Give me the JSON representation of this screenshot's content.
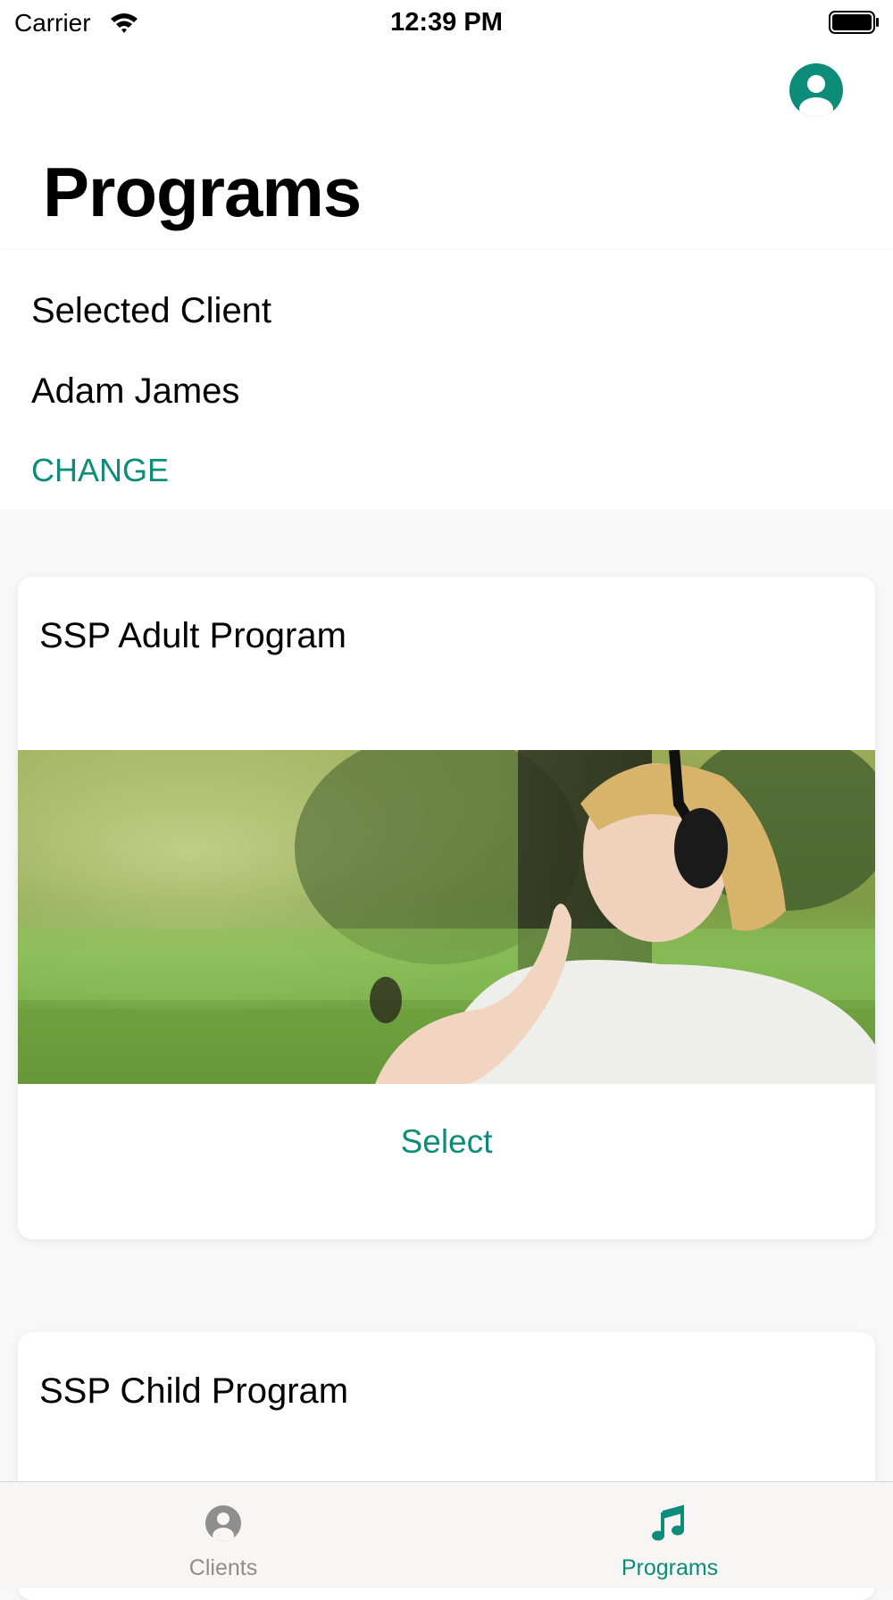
{
  "status_bar": {
    "carrier": "Carrier",
    "time": "12:39 PM"
  },
  "header": {
    "title": "Programs",
    "profile_icon": "person-circle-icon"
  },
  "client": {
    "heading": "Selected Client",
    "name": "Adam James",
    "change_label": "CHANGE"
  },
  "programs": [
    {
      "title": "SSP Adult Program",
      "select_label": "Select"
    },
    {
      "title": "SSP Child Program"
    }
  ],
  "tabs": [
    {
      "label": "Clients",
      "icon": "person-icon",
      "active": false
    },
    {
      "label": "Programs",
      "icon": "music-note-icon",
      "active": true
    }
  ],
  "colors": {
    "accent": "#0e8c7a",
    "inactive_tab": "#8e8e8e",
    "background": "#f8f8f8"
  }
}
